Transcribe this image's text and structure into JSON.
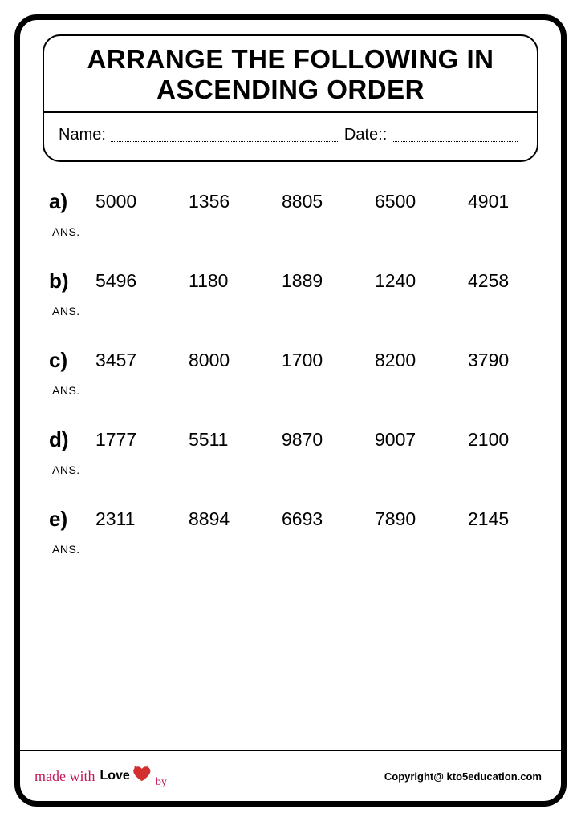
{
  "title": "ARRANGE THE FOLLOWING IN ASCENDING ORDER",
  "fields": {
    "name_label": "Name:",
    "date_label": "Date::"
  },
  "ans_label": "ANS.",
  "problems": [
    {
      "letter": "a)",
      "numbers": [
        "5000",
        "1356",
        "8805",
        "6500",
        "4901"
      ]
    },
    {
      "letter": "b)",
      "numbers": [
        "5496",
        "1180",
        "1889",
        "1240",
        "4258"
      ]
    },
    {
      "letter": "c)",
      "numbers": [
        "3457",
        "8000",
        "1700",
        "8200",
        "3790"
      ]
    },
    {
      "letter": "d)",
      "numbers": [
        "1777",
        "5511",
        "9870",
        "9007",
        "2100"
      ]
    },
    {
      "letter": "e)",
      "numbers": [
        "2311",
        "8894",
        "6693",
        "7890",
        "2145"
      ]
    }
  ],
  "footer": {
    "made1": "made with",
    "made2": "Love",
    "made3": "by",
    "copyright": "Copyright@ kto5education.com"
  }
}
